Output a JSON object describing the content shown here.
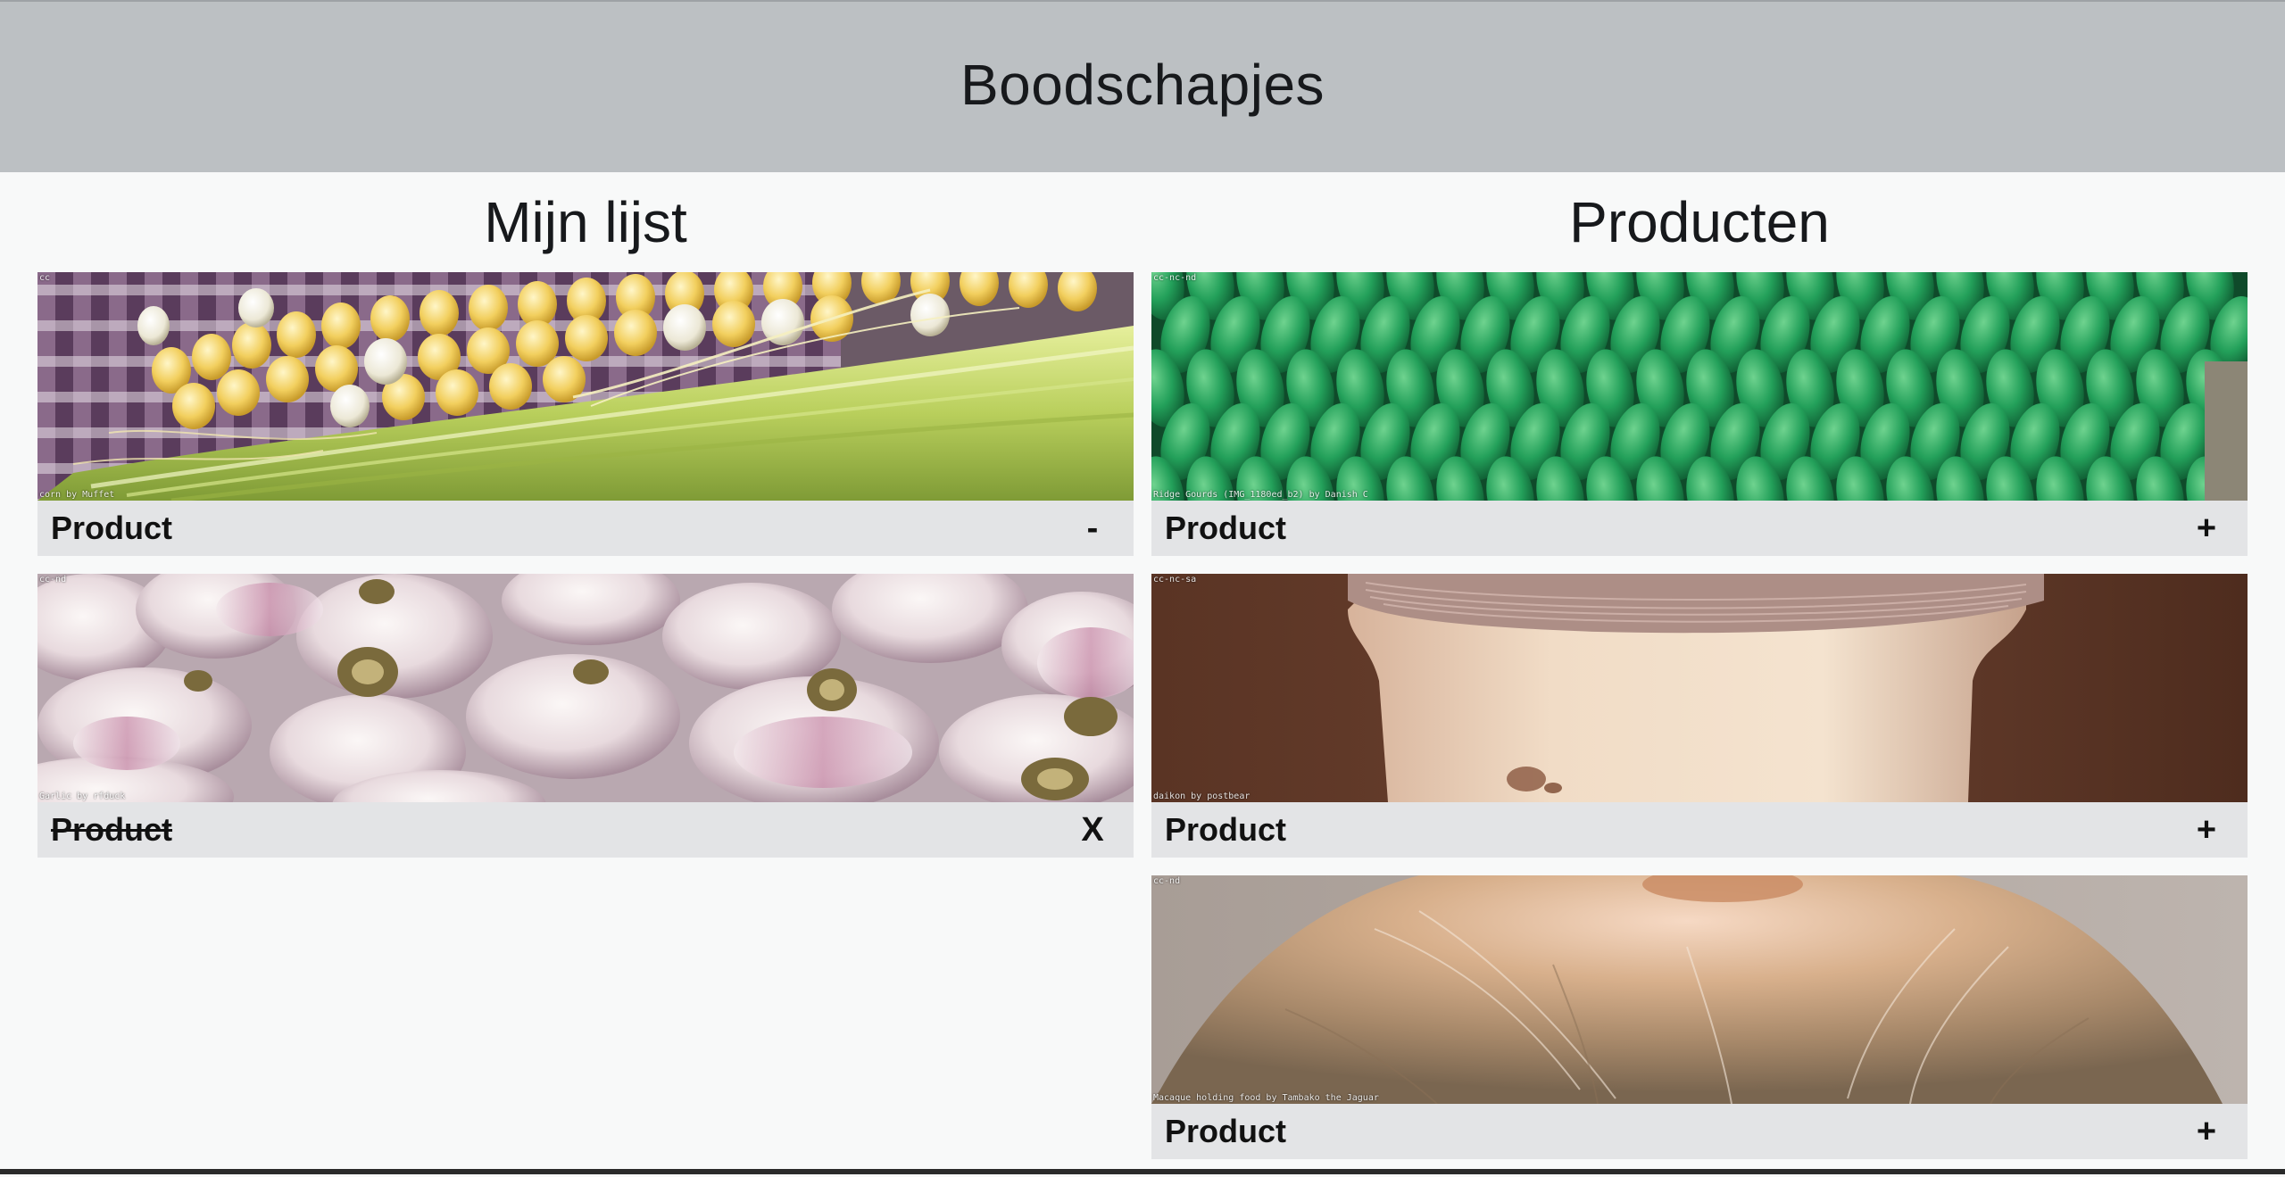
{
  "header": {
    "title": "Boodschapjes"
  },
  "my_list": {
    "title": "Mijn lijst",
    "items": [
      {
        "license": "cc",
        "caption": "corn by Muffet",
        "label": "Product",
        "action": "-",
        "done": false
      },
      {
        "license": "cc-nd",
        "caption": "Garlic by rfduck",
        "label": "Product",
        "action": "X",
        "done": true
      }
    ]
  },
  "products": {
    "title": "Producten",
    "items": [
      {
        "license": "cc-nc-nd",
        "caption": "Ridge Gourds (IMG_1180ed_b2) by Danish C",
        "label": "Product",
        "action": "+"
      },
      {
        "license": "cc-nc-sa",
        "caption": "daikon by postbear",
        "label": "Product",
        "action": "+"
      },
      {
        "license": "cc-nd",
        "caption": "Macaque holding food by Tambako the Jaguar",
        "label": "Product",
        "action": "+"
      }
    ]
  },
  "colors": {
    "header_bg": "#bcc0c3",
    "page_bg": "#f8f9f9",
    "card_bar_bg": "#e3e4e6"
  }
}
